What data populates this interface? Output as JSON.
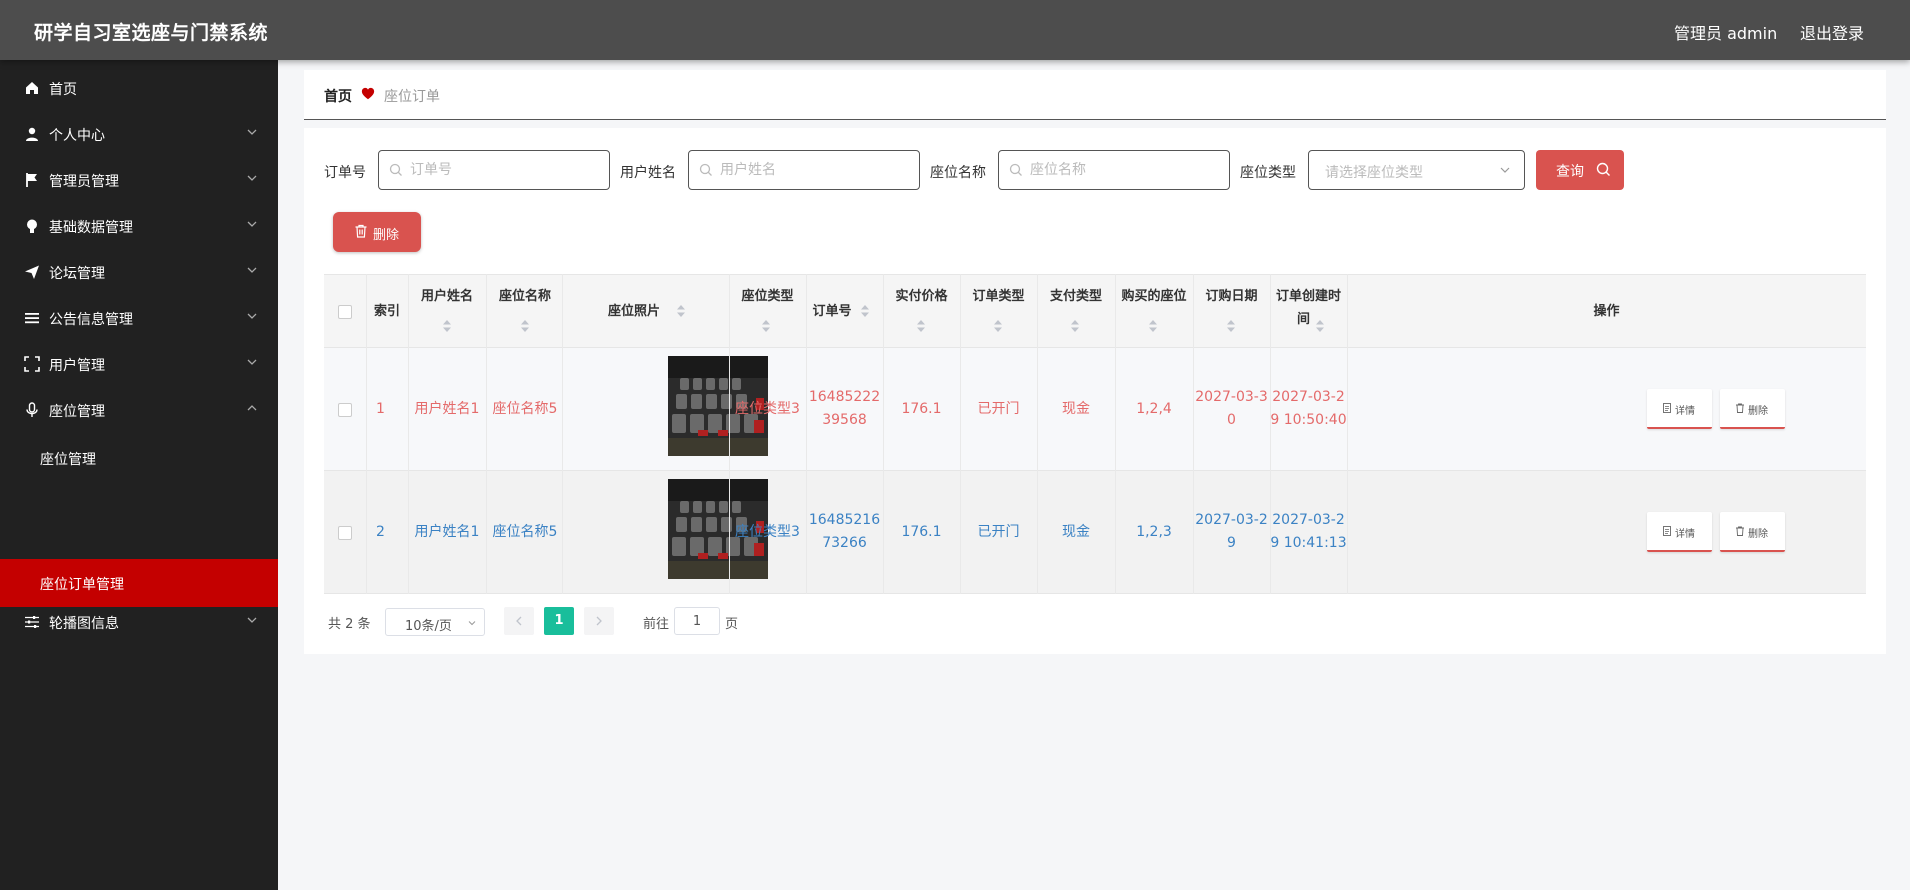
{
  "header": {
    "app_title": "研学自习室选座与门禁系统",
    "admin_label": "管理员 admin",
    "logout_label": "退出登录"
  },
  "sidebar": {
    "items": [
      {
        "label": "首页",
        "icon": "home-icon"
      },
      {
        "label": "个人中心",
        "icon": "user-icon"
      },
      {
        "label": "管理员管理",
        "icon": "flag-icon"
      },
      {
        "label": "基础数据管理",
        "icon": "bulb-icon"
      },
      {
        "label": "论坛管理",
        "icon": "send-icon"
      },
      {
        "label": "公告信息管理",
        "icon": "list-icon"
      },
      {
        "label": "用户管理",
        "icon": "frame-icon"
      },
      {
        "label": "座位管理",
        "icon": "mic-icon"
      },
      {
        "label": "轮播图信息",
        "icon": "sliders-icon"
      }
    ],
    "sub_items": [
      {
        "label": "座位管理"
      },
      {
        "label": "座位订单管理"
      }
    ]
  },
  "breadcrumb": {
    "home": "首页",
    "current": "座位订单"
  },
  "search": {
    "order_no_label": "订单号",
    "order_no_placeholder": "订单号",
    "user_name_label": "用户姓名",
    "user_name_placeholder": "用户姓名",
    "seat_name_label": "座位名称",
    "seat_name_placeholder": "座位名称",
    "seat_type_label": "座位类型",
    "seat_type_placeholder": "请选择座位类型",
    "query_label": "查询"
  },
  "toolbar": {
    "delete_label": "删除"
  },
  "table": {
    "headers": {
      "index": "索引",
      "user_name": "用户姓名",
      "seat_name": "座位名称",
      "seat_photo": "座位照片",
      "seat_type": "座位类型",
      "order_no": "订单号",
      "price": "实付价格",
      "order_type": "订单类型",
      "pay_type": "支付类型",
      "seats": "购买的座位",
      "order_date": "订购日期",
      "created_a": "订单创建时",
      "created_b": "间",
      "actions": "操作"
    },
    "rows": [
      {
        "index": "1",
        "user_name": "用户姓名1",
        "seat_name": "座位名称5",
        "seat_type": "座位类型3",
        "order_no_a": "16485222",
        "order_no_b": "39568",
        "price": "176.1",
        "order_type": "已开门",
        "pay_type": "现金",
        "seats": "1,2,4",
        "date_a": "2027-03-3",
        "date_b": "0",
        "created_a": "2027-03-2",
        "created_b": "9 10:50:40",
        "detail_label": "详情",
        "delete_label": "删除"
      },
      {
        "index": "2",
        "user_name": "用户姓名1",
        "seat_name": "座位名称5",
        "seat_type": "座位类型3",
        "order_no_a": "16485216",
        "order_no_b": "73266",
        "price": "176.1",
        "order_type": "已开门",
        "pay_type": "现金",
        "seats": "1,2,3",
        "date_a": "2027-03-2",
        "date_b": "9",
        "created_a": "2027-03-2",
        "created_b": "9 10:41:13",
        "detail_label": "详情",
        "delete_label": "删除"
      }
    ]
  },
  "pagination": {
    "total": "共 2 条",
    "page_size": "10条/页",
    "current_page": "1",
    "goto_label": "前往",
    "goto_value": "1",
    "page_suffix": "页"
  },
  "colors": {
    "accent_red": "#d9534f",
    "active_menu": "#c40000",
    "header_bg": "#4d4d4d",
    "sidebar_bg": "#212121",
    "page_active": "#19be9b"
  }
}
